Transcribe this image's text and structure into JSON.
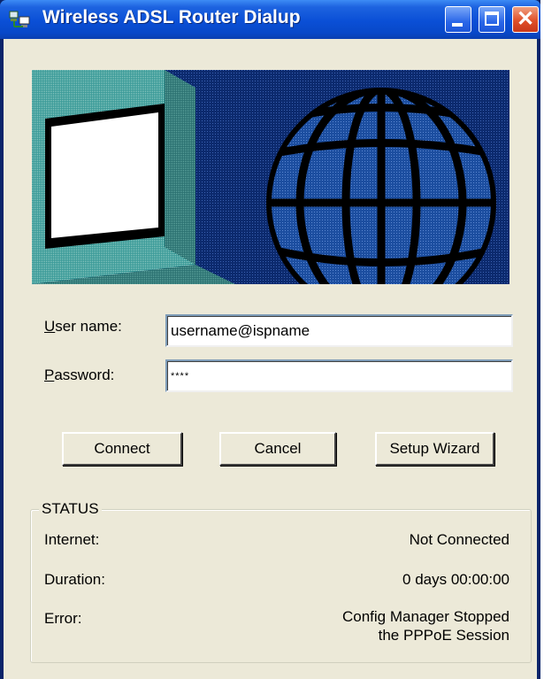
{
  "window": {
    "title": "Wireless ADSL Router Dialup",
    "controls": {
      "minimize": "minimize",
      "maximize": "maximize",
      "close": "✕"
    }
  },
  "form": {
    "username_label_u": "U",
    "username_label_rest": "ser name:",
    "username_value": "username@ispname",
    "password_label_u": "P",
    "password_label_rest": "assword:",
    "password_value": "****"
  },
  "buttons": {
    "connect": "Connect",
    "cancel": "Cancel",
    "setup_wizard": "Setup Wizard"
  },
  "status": {
    "title": "STATUS",
    "rows": [
      {
        "label": "Internet:",
        "value": "Not Connected"
      },
      {
        "label": "Duration:",
        "value": "0 days 00:00:00"
      },
      {
        "label": "Error:",
        "value_line1": "Config Manager Stopped",
        "value_line2": "the PPPoE Session"
      }
    ]
  },
  "colors": {
    "titlebar": "#0a4fd6",
    "dialog_bg": "#ece9d8",
    "banner_navy": "#0c2a6e",
    "banner_teal": "#3a9a98",
    "globe_blue": "#1c4ea0"
  }
}
